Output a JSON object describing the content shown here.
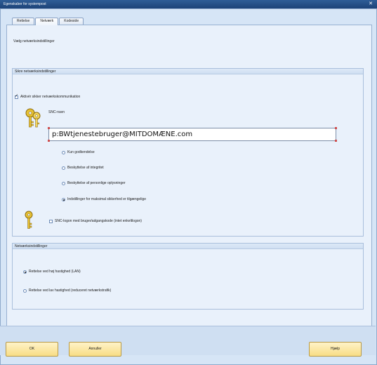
{
  "window": {
    "title": "Egenskaber for systempost",
    "close_glyph": "✕"
  },
  "tabs": [
    {
      "label": "Rettelse",
      "active": false
    },
    {
      "label": "Netværk",
      "active": true
    },
    {
      "label": "Kodeside",
      "active": false
    }
  ],
  "main": {
    "heading": "Vælg netværksindstillinger"
  },
  "secure_group": {
    "title": "Sikre netværksindstillinger",
    "enable_checkbox": {
      "label": "Aktivér sikker netværkskommunikation",
      "checked": true
    },
    "snc_name_label": "SNC-navn",
    "snc_name_value": "p:BWtjenestebruger@MITDOMÆNE.com",
    "security_options": [
      {
        "label": "Kun godkendelse",
        "checked": false
      },
      {
        "label": "Beskyttelse af integritet",
        "checked": false
      },
      {
        "label": "Beskyttelse af personlige oplysninger",
        "checked": false
      },
      {
        "label": "Indstillinger for maksimal sikkerhed er tilgængelige",
        "checked": true
      }
    ],
    "snc_logon_checkbox": {
      "label": "SNC-logon med bruger/adgangskode (intet enkeltlogon)",
      "checked": false
    }
  },
  "network_group": {
    "title": "Netværksindstillinger",
    "options": [
      {
        "label": "Rettelse ved høj hastighed (LAN)",
        "checked": true
      },
      {
        "label": "Rettelse ved lav hastighed (reduceret netværkstrafik)",
        "checked": false
      }
    ]
  },
  "buttons": {
    "ok": "OK",
    "cancel": "Annuller",
    "help": "Hjælp"
  },
  "icons": {
    "keys": "keys-icon",
    "key": "key-icon"
  },
  "colors": {
    "titlebar": "#1c4378",
    "button_fill": "#f8dd85",
    "panel_bg": "#e9f1fb"
  }
}
